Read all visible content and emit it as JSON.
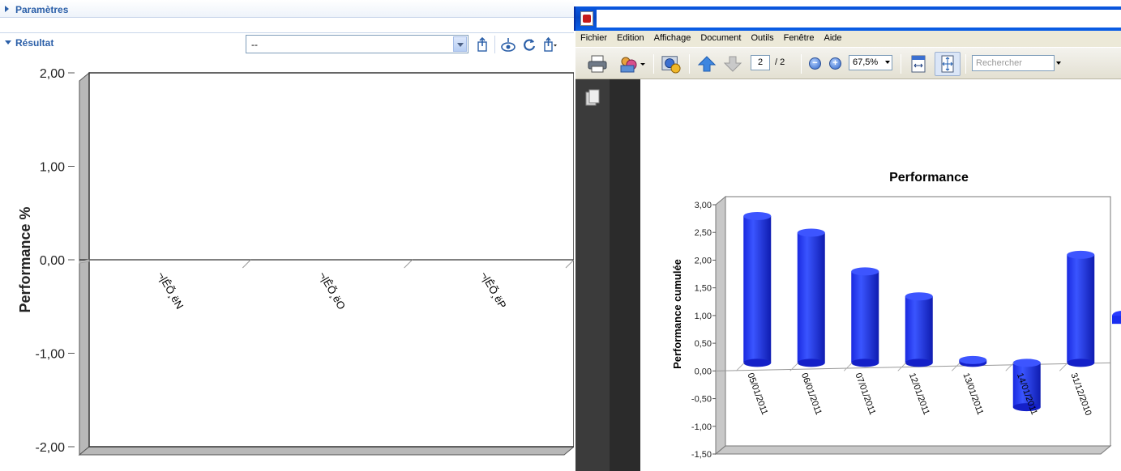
{
  "left_panel": {
    "params_section": {
      "label": "Paramètres"
    },
    "result_section": {
      "label": "Résultat"
    },
    "result_select": {
      "value": "--"
    },
    "toolbar_icons": [
      "export-icon",
      "view-icon",
      "refresh-icon",
      "export-menu-icon"
    ]
  },
  "chart_data": [
    {
      "type": "bar",
      "ylabel": "Performance %",
      "ylim": [
        -2.0,
        2.0
      ],
      "yticks": [
        "2,00",
        "1,00",
        "0,00",
        "-1,00",
        "-2,00"
      ],
      "categories": [
        "¬|ÊÕ¸ëN",
        "¬|ÊÕ¸ëO",
        "¬|ÊÕ¸ëP"
      ],
      "values": [
        0,
        0,
        0
      ],
      "grid": false,
      "style": "3d-frame"
    },
    {
      "type": "bar",
      "title": "Performance",
      "ylabel": "Performance cumulée",
      "ylim": [
        -1.5,
        3.0
      ],
      "yticks": [
        "3,00",
        "2,50",
        "2,00",
        "1,50",
        "1,00",
        "0,50",
        "0,00",
        "-0,50",
        "-1,00",
        "-1,50"
      ],
      "categories": [
        "05/01/2011",
        "06/01/2011",
        "07/01/2011",
        "12/01/2011",
        "13/01/2011",
        "14/01/2011",
        "31/12/2010"
      ],
      "values": [
        2.65,
        2.35,
        1.65,
        1.2,
        0.05,
        -0.8,
        1.95
      ],
      "color": "#1a33ff",
      "style": "3d-cylinder"
    }
  ],
  "pdf_viewer": {
    "menu": [
      "Fichier",
      "Edition",
      "Affichage",
      "Document",
      "Outils",
      "Fenêtre",
      "Aide"
    ],
    "page_current": "2",
    "page_total": "/ 2",
    "zoom": "67,5%",
    "search_placeholder": "Rechercher"
  }
}
